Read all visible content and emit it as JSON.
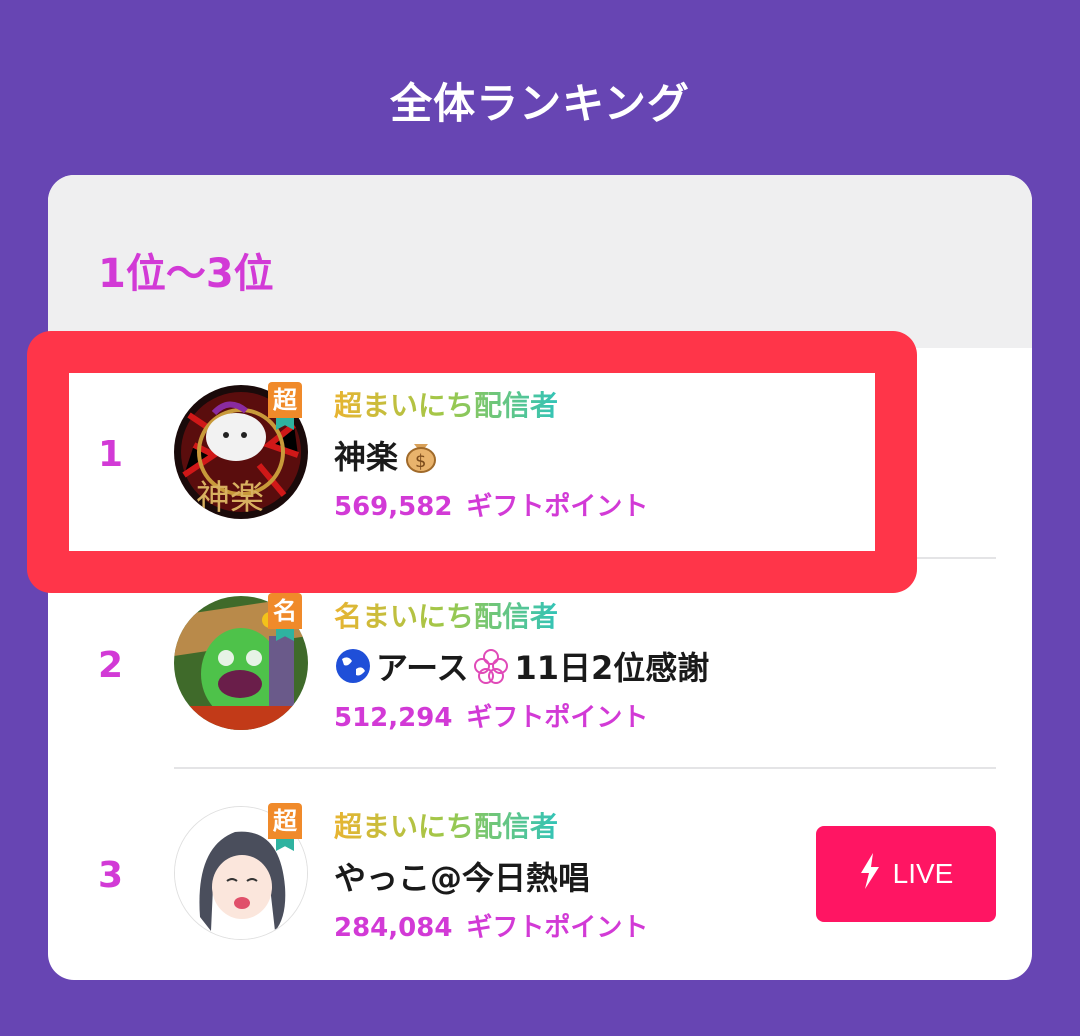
{
  "page": {
    "title": "全体ランキング"
  },
  "section": {
    "title": "1位〜3位"
  },
  "ranking": [
    {
      "rank": "1",
      "streamer_type": "超まいにち配信者",
      "badge": "超",
      "name": "神楽",
      "name_icon": "money-bag-icon",
      "points": "569,582",
      "points_unit": "ギフトポイント"
    },
    {
      "rank": "2",
      "streamer_type": "名まいにち配信者",
      "badge": "名",
      "name_prefix_icon": "earth-globe-icon",
      "name": "アース",
      "name_mid_icon": "flower-icon",
      "name_suffix": "11日2位感謝",
      "points": "512,294",
      "points_unit": "ギフトポイント"
    },
    {
      "rank": "3",
      "streamer_type": "超まいにち配信者",
      "badge": "超",
      "name": "やっこ@今日熱唱",
      "points": "284,084",
      "points_unit": "ギフトポイント",
      "live_label": "LIVE",
      "live_icon": "lightning-icon"
    }
  ],
  "colors": {
    "background": "#6745b3",
    "accent": "#d23ad6",
    "live": "#ff1563",
    "highlight": "#ff3549",
    "badge": "#f08a2a"
  }
}
